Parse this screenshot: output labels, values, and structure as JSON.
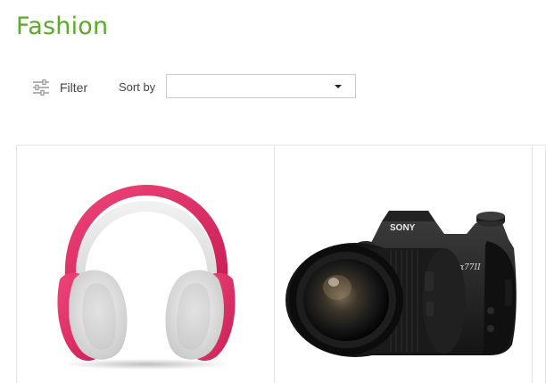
{
  "page": {
    "title": "Fashion"
  },
  "toolbar": {
    "filter_label": "Filter",
    "filter_icon": "sliders-icon",
    "sort_label": "Sort by",
    "sort_value": "",
    "sort_icon": "chevron-down-icon"
  },
  "products": [
    {
      "name": "Headphones",
      "image": "pink-white-over-ear-headphones"
    },
    {
      "name": "Camera",
      "image": "sony-alpha-dslr-camera-with-lens",
      "brand_text": "SONY",
      "model_text": "α77II"
    }
  ],
  "colors": {
    "title_green": "#5aab25",
    "headphone_pink": "#e8356b",
    "camera_body": "#1c1c1c",
    "border": "#e6e6e6"
  }
}
